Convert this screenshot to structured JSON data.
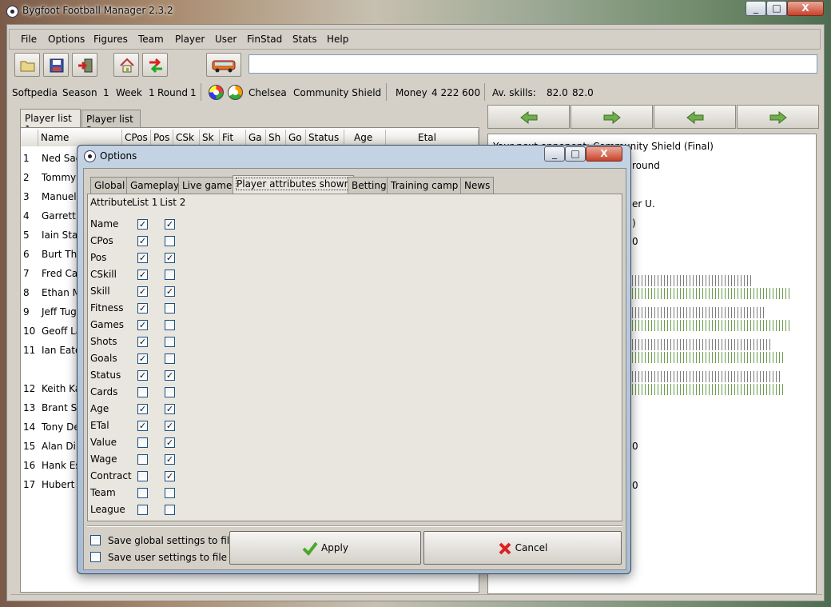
{
  "window": {
    "title": "Bygfoot Football Manager 2.3.2",
    "min": "_",
    "max": "□",
    "close": "X"
  },
  "menu": [
    {
      "label": "File"
    },
    {
      "label": "Options"
    },
    {
      "label": "Figures"
    },
    {
      "label": "Team"
    },
    {
      "label": "Player"
    },
    {
      "label": "User"
    },
    {
      "label": "FinStad"
    },
    {
      "label": "Stats"
    },
    {
      "label": "Help"
    }
  ],
  "toolbar": {
    "icons": [
      "open-folder-icon",
      "save-icon",
      "exit-icon",
      "home-icon",
      "swap-arrows-icon",
      "bus-icon"
    ],
    "entry_value": ""
  },
  "info": {
    "user": "Softpedia",
    "season_label": "Season",
    "season": "1",
    "week_label": "Week",
    "week": "1",
    "round_label": "Round",
    "round": "1",
    "team": "Chelsea",
    "league": "Community Shield",
    "money_label": "Money",
    "money": "4 222 600",
    "skills_label": "Av. skills:",
    "skill1": "82.0",
    "skill2": "82.0"
  },
  "left_tabs": [
    "Player list 1",
    "Player list 2"
  ],
  "player_columns": [
    "Name",
    "CPos",
    "Pos",
    "CSk",
    "Sk",
    "Fit",
    "Ga",
    "Sh",
    "Go",
    "Status",
    "Age",
    "Etal"
  ],
  "players": [
    {
      "num": "1",
      "name": "Ned Sag"
    },
    {
      "num": "2",
      "name": "Tommy"
    },
    {
      "num": "3",
      "name": "Manuel"
    },
    {
      "num": "4",
      "name": "Garrett"
    },
    {
      "num": "5",
      "name": "Iain Sta"
    },
    {
      "num": "6",
      "name": "Burt Tho"
    },
    {
      "num": "7",
      "name": "Fred Ca"
    },
    {
      "num": "8",
      "name": "Ethan M"
    },
    {
      "num": "9",
      "name": "Jeff Tug"
    },
    {
      "num": "10",
      "name": "Geoff La"
    },
    {
      "num": "11",
      "name": "Ian Eato"
    },
    {
      "num": "12",
      "name": "Keith Ka"
    },
    {
      "num": "13",
      "name": "Brant St"
    },
    {
      "num": "14",
      "name": "Tony De"
    },
    {
      "num": "15",
      "name": "Alan Dil"
    },
    {
      "num": "16",
      "name": "Hank Es"
    },
    {
      "num": "17",
      "name": "Hubert T"
    }
  ],
  "right_panel": {
    "line1": "Your next opponent: Community Shield (Final)",
    "line2": "round",
    "line3": "er U.",
    "frag1": ")",
    "frag2": "0",
    "frag3": "0",
    "frag4": "0"
  },
  "dialog": {
    "title": "Options",
    "min": "_",
    "max": "□",
    "close": "X",
    "tabs": [
      "Global",
      "Gameplay",
      "Live game",
      "Player attributes shown",
      "Betting",
      "Training camp",
      "News"
    ],
    "active_tab": 3,
    "col_attr": "Attribute",
    "col_l1": "List 1",
    "col_l2": "List 2",
    "attributes": [
      {
        "name": "Name",
        "l1": true,
        "l2": true
      },
      {
        "name": "CPos",
        "l1": true,
        "l2": false
      },
      {
        "name": "Pos",
        "l1": true,
        "l2": true
      },
      {
        "name": "CSkill",
        "l1": true,
        "l2": false
      },
      {
        "name": "Skill",
        "l1": true,
        "l2": true
      },
      {
        "name": "Fitness",
        "l1": true,
        "l2": false
      },
      {
        "name": "Games",
        "l1": true,
        "l2": false
      },
      {
        "name": "Shots",
        "l1": true,
        "l2": false
      },
      {
        "name": "Goals",
        "l1": true,
        "l2": false
      },
      {
        "name": "Status",
        "l1": true,
        "l2": true
      },
      {
        "name": "Cards",
        "l1": false,
        "l2": false
      },
      {
        "name": "Age",
        "l1": true,
        "l2": true
      },
      {
        "name": "ETal",
        "l1": true,
        "l2": true
      },
      {
        "name": "Value",
        "l1": false,
        "l2": true
      },
      {
        "name": "Wage",
        "l1": false,
        "l2": true
      },
      {
        "name": "Contract",
        "l1": false,
        "l2": true
      },
      {
        "name": "Team",
        "l1": false,
        "l2": false
      },
      {
        "name": "League",
        "l1": false,
        "l2": false
      }
    ],
    "save_global": "Save global settings to file",
    "save_user": "Save user settings to file",
    "apply": "Apply",
    "cancel": "Cancel"
  }
}
